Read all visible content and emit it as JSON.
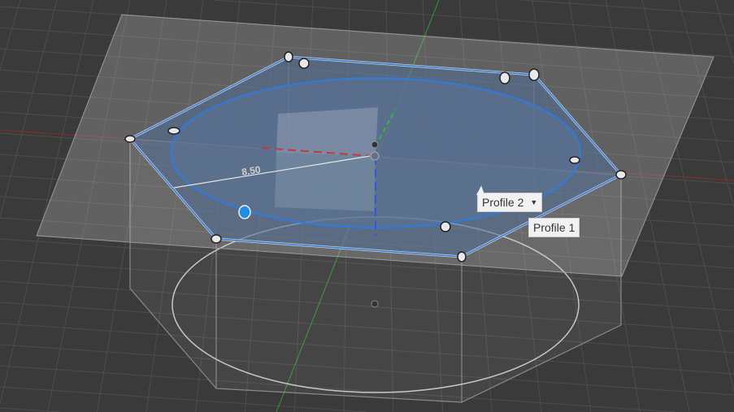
{
  "viewport": {
    "dimension_label": "8.50",
    "profiles": [
      {
        "label": "Profile 2",
        "has_dropdown": true
      },
      {
        "label": "Profile 1"
      }
    ]
  },
  "colors": {
    "background": "#3a3a3a",
    "sketch_blue": "#2f7be0",
    "x_axis": "#c0393b",
    "y_axis": "#3ab43a",
    "z_axis": "#3355dd",
    "profile_fill": "#5a7192"
  }
}
